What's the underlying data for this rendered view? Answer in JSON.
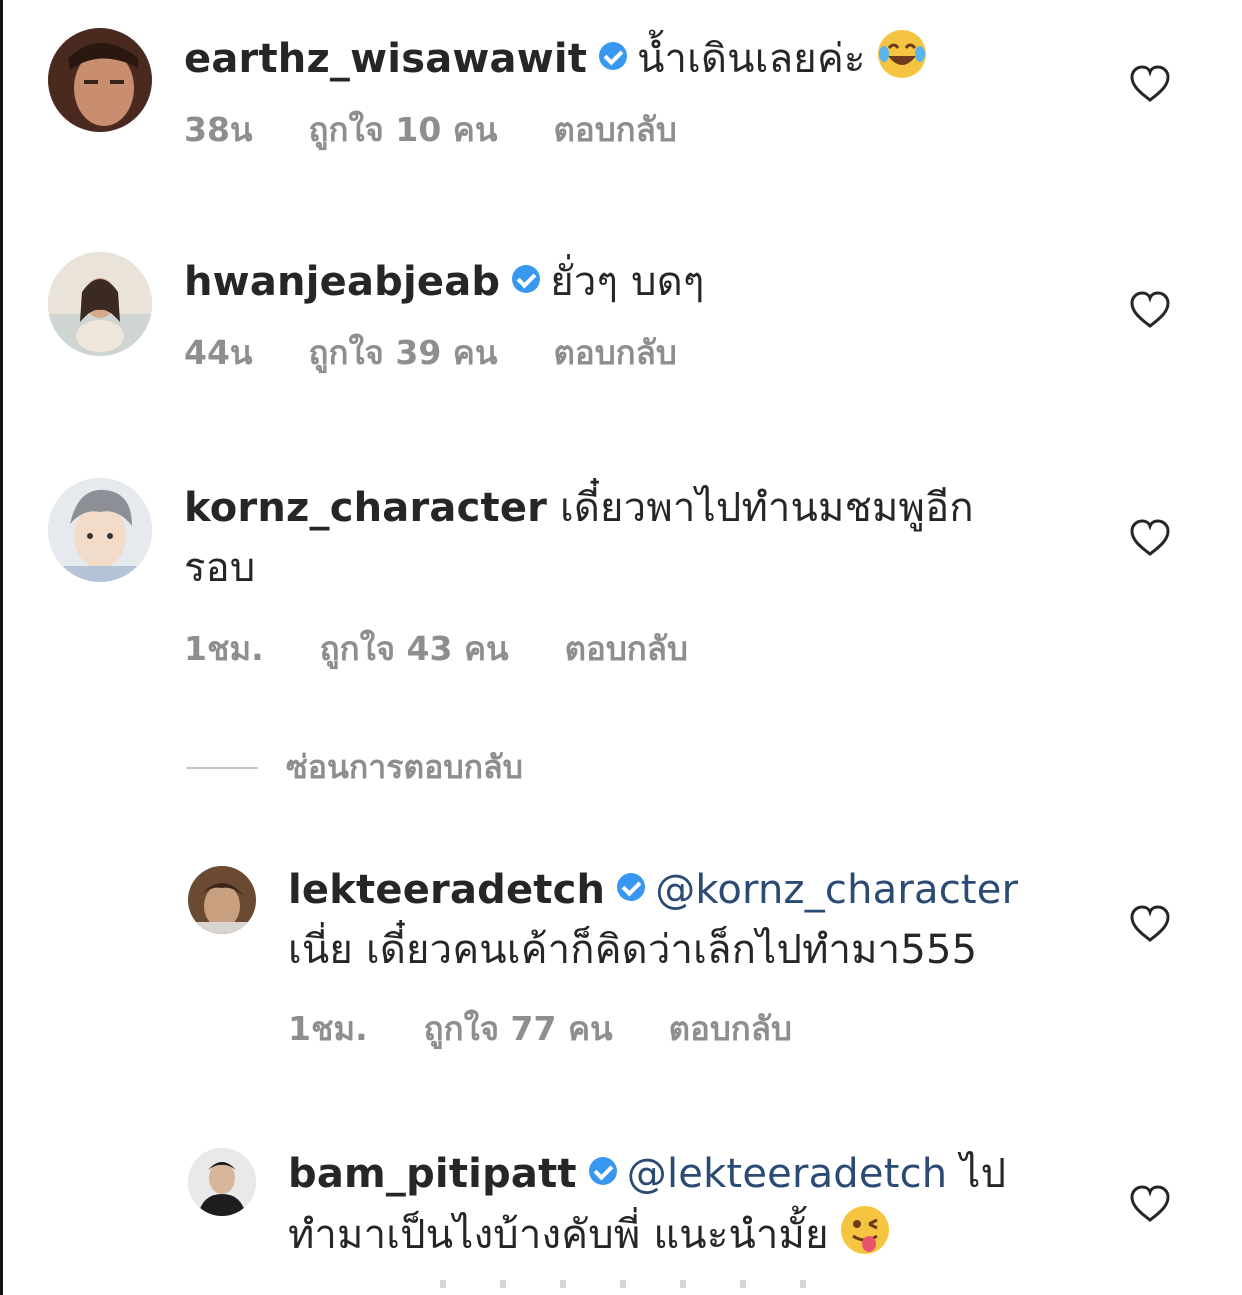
{
  "comments": [
    {
      "username": "earthz_wisawawit",
      "verified": true,
      "text": "น้ำเดินเลยค่ะ",
      "emoji": "laughing-tears-emoji",
      "time": "38น",
      "likes": "ถูกใจ 10 คน",
      "reply": "ตอบกลับ"
    },
    {
      "username": "hwanjeabjeab",
      "verified": true,
      "text": "ยั่วๆ บดๆ",
      "time": "44น",
      "likes": "ถูกใจ 39 คน",
      "reply": "ตอบกลับ"
    },
    {
      "username": "kornz_character",
      "verified": false,
      "text": "เดี๋ยวพาไปทำนมชมพูอีก รอบ",
      "time": "1ชม.",
      "likes": "ถูกใจ 43 คน",
      "reply": "ตอบกลับ"
    }
  ],
  "hide_replies": "ซ่อนการตอบกลับ",
  "replies": [
    {
      "username": "lekteeradetch",
      "verified": true,
      "mention": "@kornz_character",
      "text": "เนี่ย เดี๋ยวคนเค้าก็คิดว่าเล็กไปทำมา555",
      "time": "1ชม.",
      "likes": "ถูกใจ 77 คน",
      "reply": "ตอบกลับ"
    },
    {
      "username": "bam_pitipatt",
      "verified": true,
      "mention": "@lekteeradetch",
      "text": "ไป ทำมาเป็นไงบ้างคับพี่ แนะนำมั้ย",
      "emoji": "winking-tongue-emoji"
    }
  ],
  "colors": {
    "verified_blue": "#3897f0",
    "meta_gray": "#8e8e8e",
    "mention_blue": "#2b4a74"
  },
  "icons": [
    "heart-icon",
    "verified-badge-icon"
  ]
}
